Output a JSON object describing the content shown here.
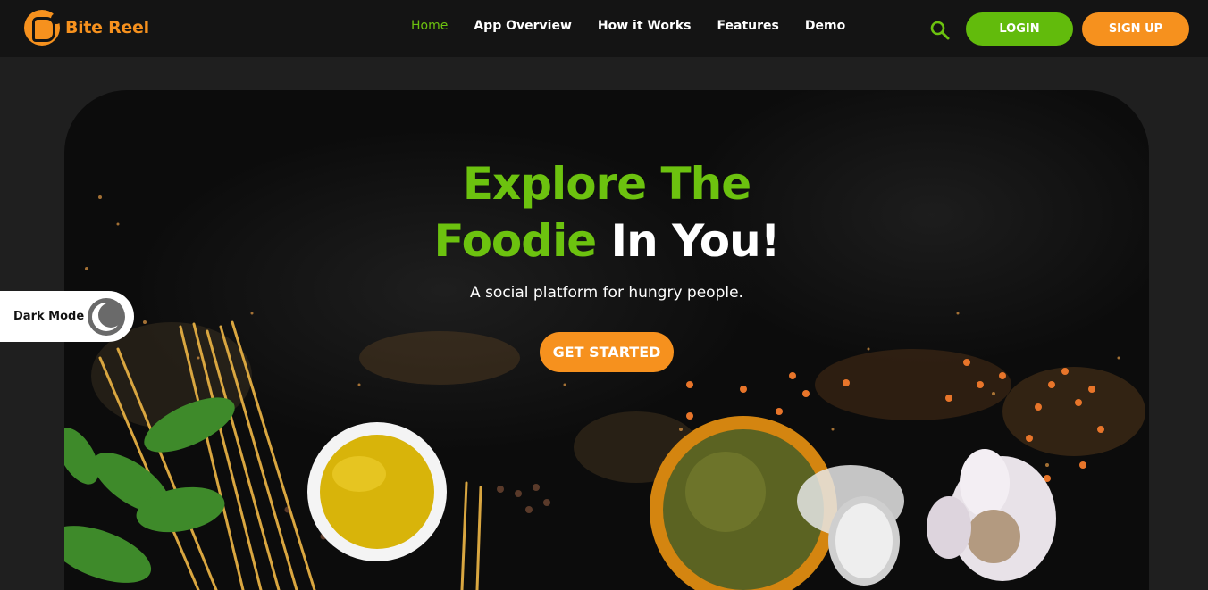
{
  "brand": {
    "name": "Bite Reel",
    "logo_icon": "bite-reel-logo"
  },
  "nav": {
    "links": [
      {
        "label": "Home",
        "active": true
      },
      {
        "label": "App Overview",
        "active": false
      },
      {
        "label": "How it Works",
        "active": false
      },
      {
        "label": "Features",
        "active": false
      },
      {
        "label": "Demo",
        "active": false
      }
    ],
    "search_icon": "search-icon",
    "login_label": "LOGIN",
    "signup_label": "SIGN UP"
  },
  "hero": {
    "headline_line1": "Explore The",
    "headline_line2_green": "Foodie",
    "headline_line2_white": "In You!",
    "subtitle": "A social platform for hungry people.",
    "cta_label": "GET STARTED",
    "background_image": "food-ingredients-on-dark-table"
  },
  "dark_mode": {
    "label": "Dark Mode",
    "icon": "moon-icon"
  },
  "colors": {
    "accent_green": "#6cc20f",
    "accent_orange": "#f6911e",
    "nav_bg": "#141414",
    "page_bg": "#1f1f1f"
  }
}
